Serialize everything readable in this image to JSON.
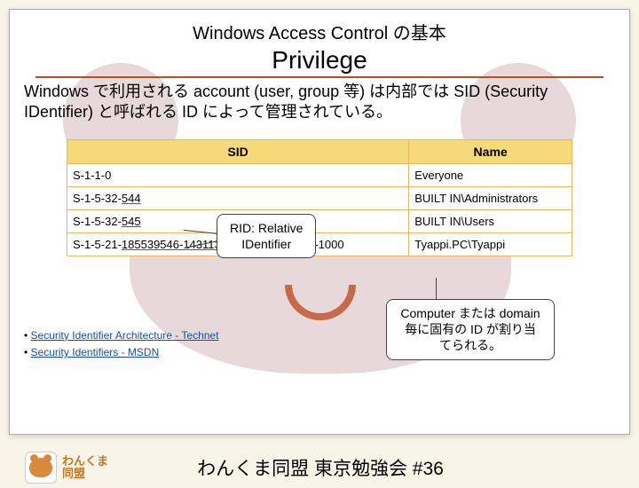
{
  "slide": {
    "heading1": "Windows Access Control の基本",
    "heading2": "Privilege",
    "description": "Windows で利用される account (user,  group 等) は内部では SID (Security IDentifier) と呼ばれる ID によって管理されている。"
  },
  "table": {
    "headers": {
      "sid": "SID",
      "name": "Name"
    },
    "rows": [
      {
        "sid_plain": "S-1-1-0",
        "name": "Everyone"
      },
      {
        "sid_prefix": "S-1-5-32-",
        "sid_rid": "544",
        "name": "BUILT IN\\Administrators"
      },
      {
        "sid_prefix": "S-1-5-32-",
        "sid_rid": "545",
        "name": "BUILT IN\\Users"
      },
      {
        "sid_prefix": "S-1-5-21-",
        "sid_mid": "185539546-1431137498-1249753232",
        "sid_rid": "-1000",
        "name": "Tyappi.PC\\Tyappi"
      }
    ]
  },
  "callouts": {
    "rid": "RID: Relative\nIDentifier",
    "computer": "Computer または domain 毎に固有の ID が割り当てられる。"
  },
  "references": {
    "r1": "Security Identifier Architecture - Technet",
    "r2": "Security Identifiers - MSDN"
  },
  "footer": {
    "logo_line1": "わんくま",
    "logo_line2": "同盟",
    "title": "わんくま同盟 東京勉強会 #36"
  }
}
